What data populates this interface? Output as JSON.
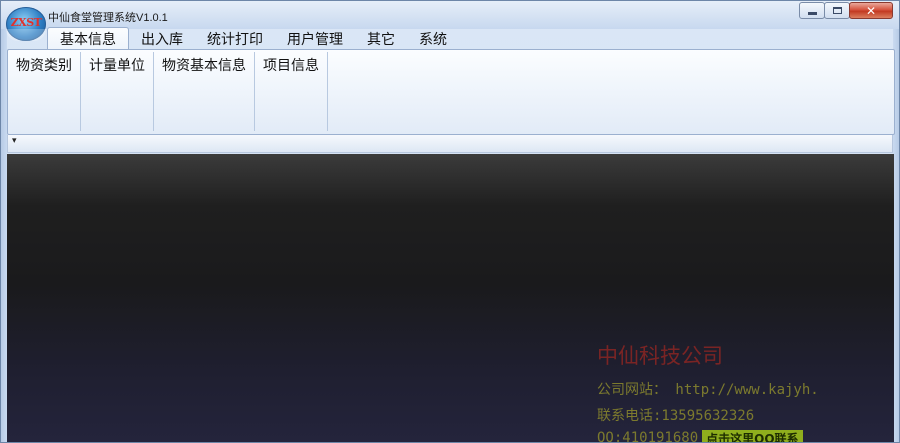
{
  "window": {
    "title": "中仙食堂管理系统V1.0.1",
    "logo_text": "ZXST",
    "controls": {
      "minimize_icon": "minimize-icon",
      "maximize_icon": "maximize-icon",
      "close_icon": "close-icon"
    }
  },
  "ribbon": {
    "tabs": [
      {
        "label": "基本信息",
        "active": true
      },
      {
        "label": "出入库"
      },
      {
        "label": "统计打印"
      },
      {
        "label": "用户管理"
      },
      {
        "label": "其它"
      },
      {
        "label": "系统"
      }
    ],
    "groups": [
      {
        "label": "物资类别"
      },
      {
        "label": "计量单位"
      },
      {
        "label": "物资基本信息"
      },
      {
        "label": "项目信息"
      }
    ],
    "qat_arrow": "▾"
  },
  "content": {
    "company_name": "中仙科技公司",
    "website_line": "公司网站： http://www.kajyh.",
    "phone_line": "联系电话:13595632326",
    "qq_line": "QQ:410191680",
    "qq_button": "点击这里QQ联系"
  },
  "colors": {
    "titlebar": "#d5e2f3",
    "content_bg": "#1f1f24",
    "company_text": "#7a2424",
    "info_text": "#7c7a2e",
    "qq_button_bg": "#8fae1d"
  }
}
